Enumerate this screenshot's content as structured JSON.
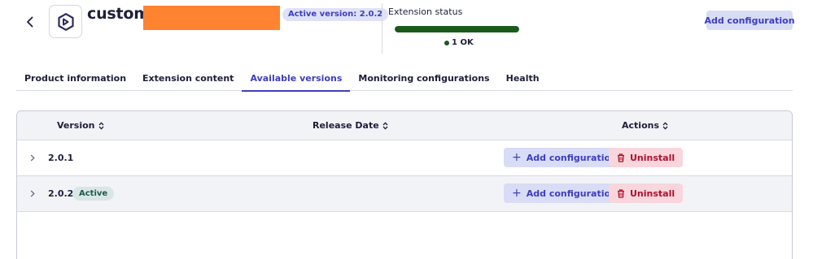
{
  "header": {
    "back_icon": "chevron-left-icon",
    "logo_icon": "extension-logo-icon",
    "title": "custom:",
    "version_badge": "Active version: 2.0.2",
    "add_configuration_label": "Add configuration"
  },
  "status": {
    "title": "Extension status",
    "ok_text": "1 OK",
    "ok_fraction": 1.0
  },
  "tabs": [
    {
      "label": "Product information",
      "active": false
    },
    {
      "label": "Extension content",
      "active": false
    },
    {
      "label": "Available versions",
      "active": true
    },
    {
      "label": "Monitoring configurations",
      "active": false
    },
    {
      "label": "Health",
      "active": false
    }
  ],
  "table": {
    "columns": [
      "Version",
      "Release Date",
      "Actions"
    ],
    "sort_icon": "sort-icon",
    "rows": [
      {
        "version": "2.0.1",
        "active_label": "",
        "add_label": "Add configuration",
        "uninstall_label": "Uninstall"
      },
      {
        "version": "2.0.2",
        "active_label": "Active",
        "add_label": "Add configuration",
        "uninstall_label": "Uninstall"
      }
    ]
  },
  "colors": {
    "accent": "#3d3ebf",
    "accent_bg": "#d8dcf5",
    "badge_bg": "#dfe2f7",
    "ok_green": "#1c5a1c",
    "danger_text": "#b0112e",
    "danger_bg": "#f8d6dc",
    "active_pill_bg": "#d9e7e4",
    "active_pill_text": "#1e5a4e",
    "redaction": "#ff8330"
  }
}
